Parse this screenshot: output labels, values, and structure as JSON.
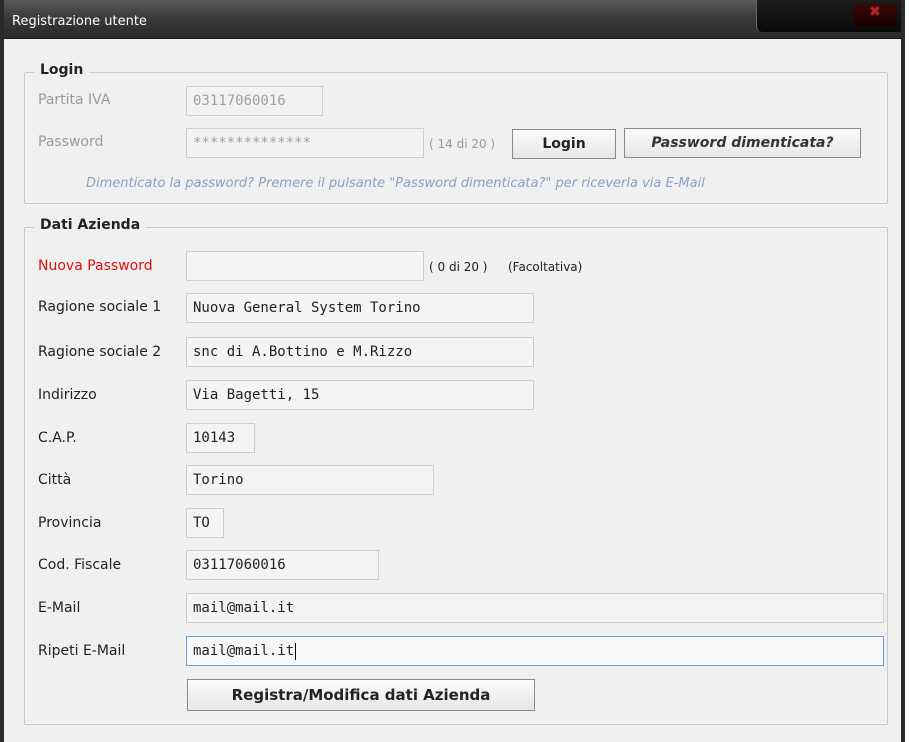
{
  "window": {
    "title": "Registrazione utente"
  },
  "login": {
    "legend": "Login",
    "partita_iva_label": "Partita IVA",
    "partita_iva_value": "03117060016",
    "password_label": "Password",
    "password_value": "**************",
    "password_counter": "( 14 di 20 )",
    "login_button": "Login",
    "forgot_button": "Password dimenticata?",
    "hint": "Dimenticato la password? Premere il pulsante \"Password dimenticata?\" per riceverla via E-Mail"
  },
  "azienda": {
    "legend": "Dati Azienda",
    "nuova_password_label": "Nuova Password",
    "nuova_password_value": "",
    "nuova_password_counter": "( 0 di 20 )",
    "nuova_password_note": "(Facoltativa)",
    "ragione1_label": "Ragione sociale 1",
    "ragione1_value": "Nuova General System Torino",
    "ragione2_label": "Ragione sociale 2",
    "ragione2_value": "snc di A.Bottino e M.Rizzo",
    "indirizzo_label": "Indirizzo",
    "indirizzo_value": "Via Bagetti, 15",
    "cap_label": "C.A.P.",
    "cap_value": "10143",
    "citta_label": "Città",
    "citta_value": "Torino",
    "provincia_label": "Provincia",
    "provincia_value": "TO",
    "codfiscale_label": "Cod. Fiscale",
    "codfiscale_value": "03117060016",
    "email_label": "E-Mail",
    "email_value": "mail@mail.it",
    "ripeti_email_label": "Ripeti E-Mail",
    "ripeti_email_value": "mail@mail.it",
    "submit_button": "Registra/Modifica dati Azienda"
  },
  "icons": {
    "close": "close-icon",
    "minimize": "minimize-icon",
    "maximize": "maximize-icon"
  }
}
